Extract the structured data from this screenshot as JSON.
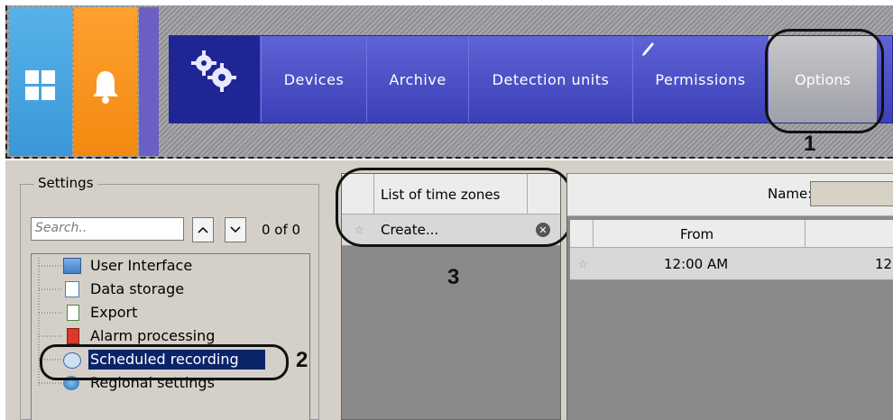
{
  "nav": {
    "items": [
      "Devices",
      "Archive",
      "Detection units",
      "Permissions",
      "Options"
    ]
  },
  "settings": {
    "title": "Settings",
    "search_placeholder": "Search..",
    "up_arrow": "^",
    "down_arrow": "v",
    "count": "0 of 0",
    "tree": [
      "User Interface",
      "Data storage",
      "Export",
      "Alarm processing",
      "Scheduled recording",
      "Regional settings"
    ]
  },
  "timezones": {
    "header": "List of time zones",
    "create": "Create..."
  },
  "schedule": {
    "name_label": "Name:",
    "col_from": "From",
    "row_from": "12:00 AM",
    "row_to_partial": "12"
  },
  "callouts": [
    "1",
    "2",
    "3"
  ]
}
